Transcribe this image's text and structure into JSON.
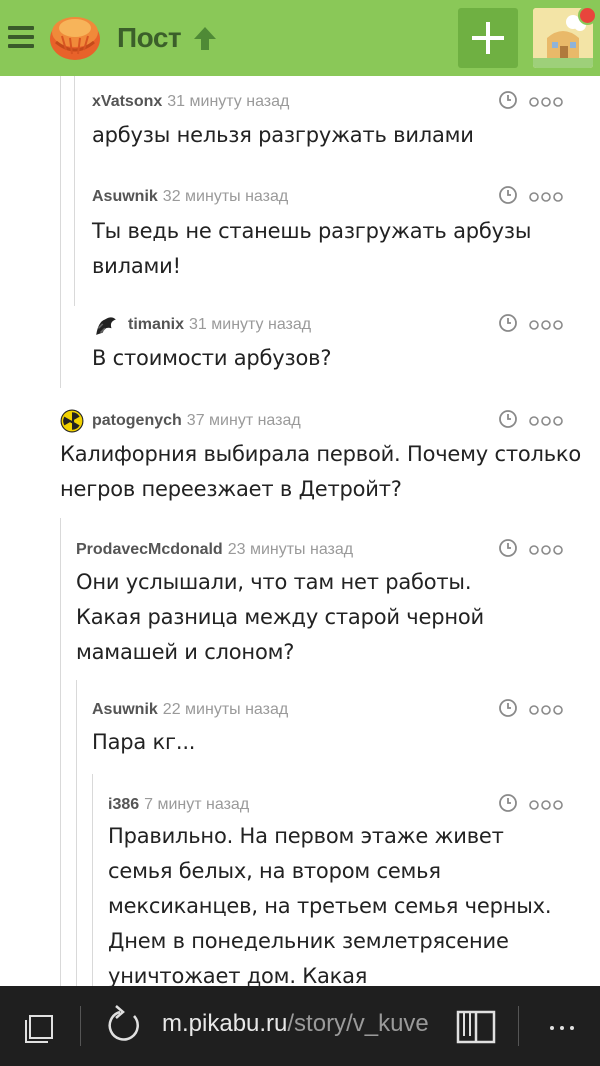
{
  "header": {
    "title": "Пост",
    "menu_icon": "hamburger-icon",
    "add_icon": "plus-icon",
    "accent_color": "#8ac858"
  },
  "comments": [
    {
      "user": "xVatsonx",
      "time": "31 минуту назад",
      "text": "арбузы нельзя разгружать вилами"
    },
    {
      "user": "Asuwnik",
      "time": "32 минуты назад",
      "text": "Ты ведь не станешь разгружать арбузы вилами!"
    },
    {
      "user": "timanix",
      "time": "31 минуту назад",
      "text": "В стоимости арбузов?"
    },
    {
      "user": "patogenych",
      "time": "37 минут назад",
      "text": "Калифорния выбирала первой. Почему столько негров переезжает в Детройт?"
    },
    {
      "user": "ProdavecMcdonald",
      "time": "23 минуты назад",
      "text": "Они услышали, что там нет работы. Какая разница между старой черной мамашей и слоном?"
    },
    {
      "user": "Asuwnik",
      "time": "22 минуты назад",
      "text": "Пара кг..."
    },
    {
      "user": "i386",
      "time": "7 минут назад",
      "text": "Правильно. На первом этаже живет семья белых, на втором семья мексиканцев, на третьем семья черных. Днем в понедельник землетрясение уничтожает дом. Какая"
    }
  ],
  "browser": {
    "url_host": "m.pikabu.ru",
    "url_path": "/story/v_kuve"
  }
}
